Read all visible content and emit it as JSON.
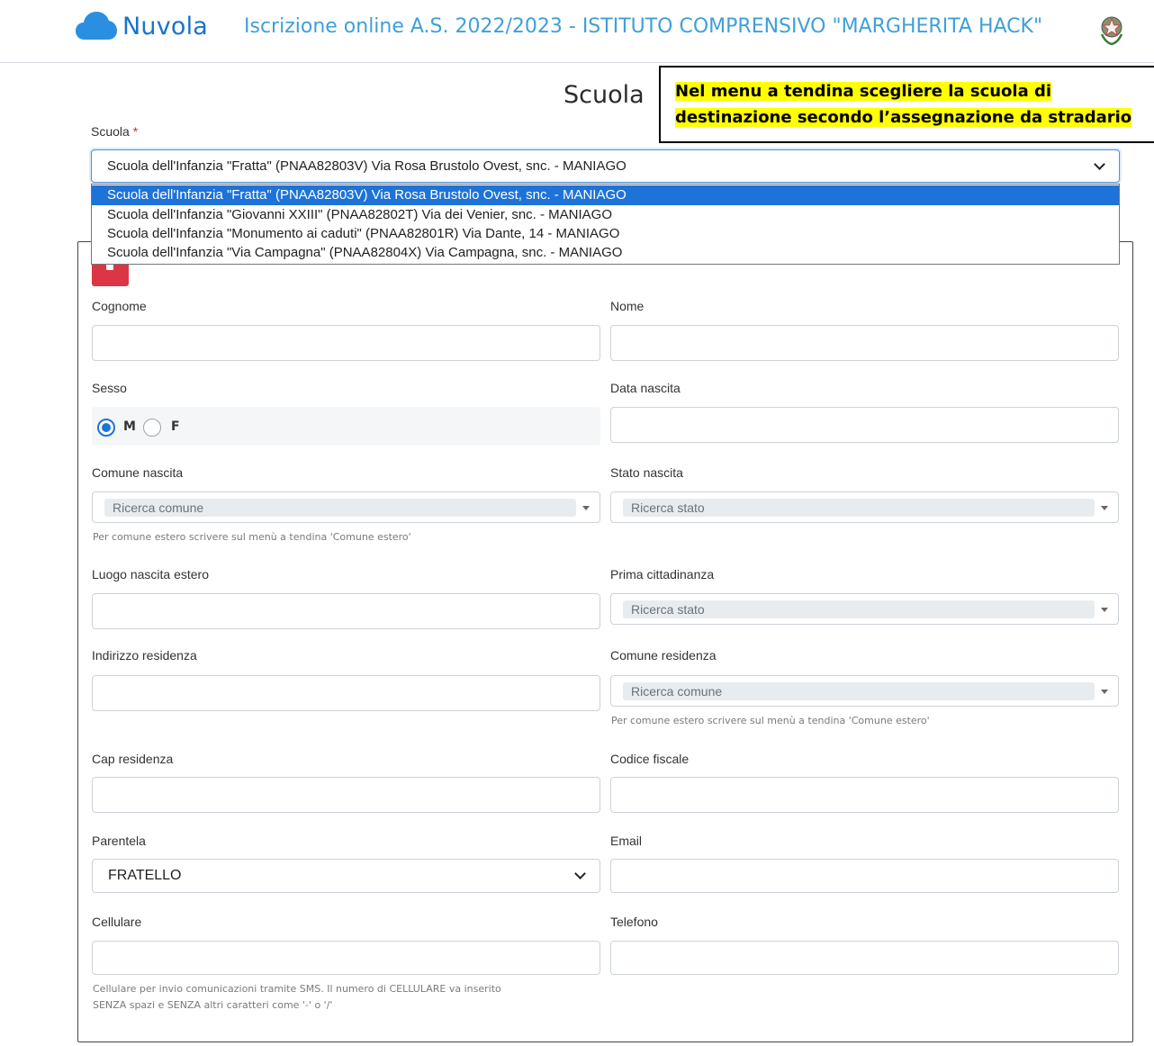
{
  "header": {
    "brand": "Nuvola",
    "title": "Iscrizione online A.S. 2022/2023 - ISTITUTO COMPRENSIVO \"MARGHERITA HACK\"",
    "cloud_color": "#2a8fe0"
  },
  "page": {
    "title": "Scuola"
  },
  "annotation": {
    "text": "Nel menu a tendina scegliere la scuola di destinazione secondo l’assegnazione da stradario"
  },
  "scuola": {
    "label": "Scuola",
    "required_mark": "*",
    "selected": "Scuola dell'Infanzia \"Fratta\" (PNAA82803V) Via Rosa Brustolo Ovest, snc. - MANIAGO",
    "options": [
      "Scuola dell'Infanzia \"Fratta\" (PNAA82803V) Via Rosa Brustolo Ovest, snc. - MANIAGO",
      "Scuola dell'Infanzia \"Giovanni XXIII\" (PNAA82802T) Via dei Venier, snc. - MANIAGO",
      "Scuola dell'Infanzia \"Monumento ai caduti\" (PNAA82801R) Via Dante, 14 - MANIAGO",
      "Scuola dell'Infanzia \"Via Campagna\" (PNAA82804X) Via Campagna, snc. - MANIAGO"
    ]
  },
  "form": {
    "cognome": {
      "label": "Cognome",
      "value": ""
    },
    "nome": {
      "label": "Nome",
      "value": ""
    },
    "sesso": {
      "label": "Sesso",
      "options": [
        "M",
        "F"
      ],
      "selected": "M"
    },
    "data_nascita": {
      "label": "Data nascita",
      "value": ""
    },
    "comune_nascita": {
      "label": "Comune nascita",
      "placeholder": "Ricerca comune",
      "hint": "Per comune estero scrivere sul menù a tendina 'Comune estero'"
    },
    "stato_nascita": {
      "label": "Stato nascita",
      "placeholder": "Ricerca stato"
    },
    "luogo_nascita_estero": {
      "label": "Luogo nascita estero",
      "value": ""
    },
    "prima_cittadinanza": {
      "label": "Prima cittadinanza",
      "placeholder": "Ricerca stato"
    },
    "indirizzo_residenza": {
      "label": "Indirizzo residenza",
      "value": ""
    },
    "comune_residenza": {
      "label": "Comune residenza",
      "placeholder": "Ricerca comune",
      "hint": "Per comune estero scrivere sul menù a tendina 'Comune estero'"
    },
    "cap_residenza": {
      "label": "Cap residenza",
      "value": ""
    },
    "codice_fiscale": {
      "label": "Codice fiscale",
      "value": ""
    },
    "parentela": {
      "label": "Parentela",
      "value": "FRATELLO"
    },
    "email": {
      "label": "Email",
      "value": ""
    },
    "cellulare": {
      "label": "Cellulare",
      "value": "",
      "hint_line1": "Cellulare per invio comunicazioni tramite SMS. Il numero di CELLULARE va inserito",
      "hint_line2": "SENZA spazi e SENZA altri caratteri come '-' o '/'"
    },
    "telefono": {
      "label": "Telefono",
      "value": ""
    }
  },
  "colors": {
    "accent": "#1e73d8",
    "brand": "#1a73c8",
    "header_title": "#3ea0d8",
    "danger": "#dc3545",
    "highlight": "#ffff00"
  }
}
